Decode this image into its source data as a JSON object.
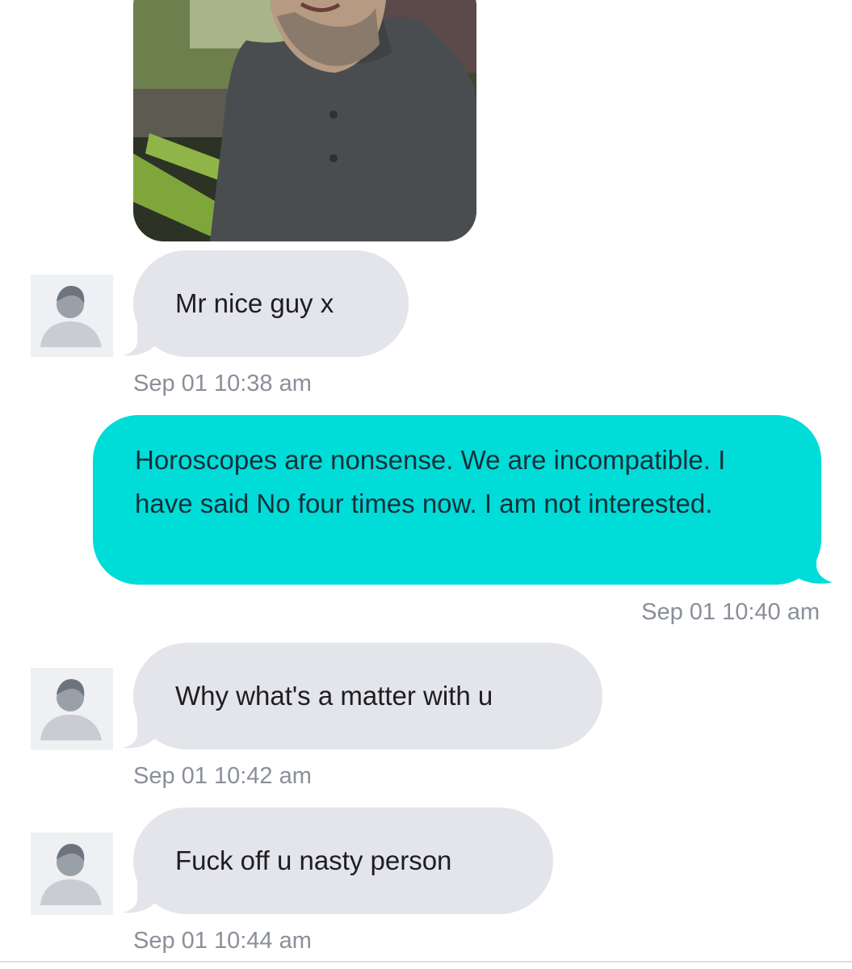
{
  "conversation": {
    "photo": {
      "alt": "Profile photo"
    },
    "messages": [
      {
        "direction": "incoming",
        "text": "Mr nice guy x",
        "timestamp": "Sep 01 10:38 am"
      },
      {
        "direction": "outgoing",
        "text": "Horoscopes are nonsense. We are incompatible. I have said No four times now. I am not interested.",
        "timestamp": "Sep 01 10:40 am"
      },
      {
        "direction": "incoming",
        "text": "Why what's a matter with u",
        "timestamp": "Sep 01 10:42 am"
      },
      {
        "direction": "incoming",
        "text": "Fuck off u nasty person",
        "timestamp": "Sep 01 10:44 am"
      }
    ]
  },
  "icons": {
    "avatar": "default-person-icon"
  },
  "colors": {
    "incoming_bubble": "#e3e5ea",
    "outgoing_bubble": "#00dcd8",
    "timestamp": "#8a8f99",
    "avatar_bg": "#eef0f3",
    "avatar_figure": "#9aa0a8"
  }
}
